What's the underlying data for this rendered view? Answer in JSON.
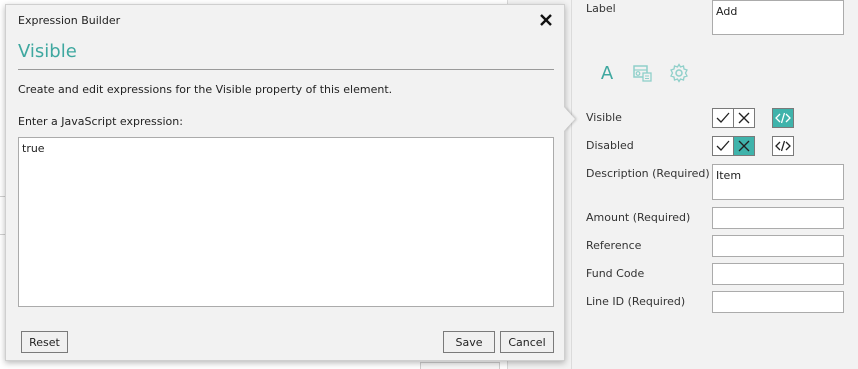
{
  "dialog": {
    "title": "Expression Builder",
    "heading": "Visible",
    "description": "Create and edit expressions for the Visible property of this element.",
    "prompt": "Enter a JavaScript expression:",
    "expression": "true",
    "reset_label": "Reset",
    "save_label": "Save",
    "cancel_label": "Cancel",
    "close_icon": "close-icon"
  },
  "properties": {
    "label_caption": "Label",
    "label_value": "Add",
    "tabs": [
      {
        "icon": "text-format-icon",
        "glyph": "A",
        "active": true
      },
      {
        "icon": "data-binding-icon",
        "active": false
      },
      {
        "icon": "settings-gear-icon",
        "active": false
      }
    ],
    "visible_caption": "Visible",
    "disabled_caption": "Disabled",
    "description_caption": "Description (Required)",
    "description_value": "Item",
    "amount_caption": "Amount (Required)",
    "amount_value": "",
    "reference_caption": "Reference",
    "reference_value": "",
    "fund_code_caption": "Fund Code",
    "fund_code_value": "",
    "line_id_caption": "Line ID (Required)",
    "line_id_value": ""
  },
  "colors": {
    "accent": "#3fa8a0",
    "toggle_active": "#3fb3ab",
    "panel_bg": "#f2f2f2"
  }
}
